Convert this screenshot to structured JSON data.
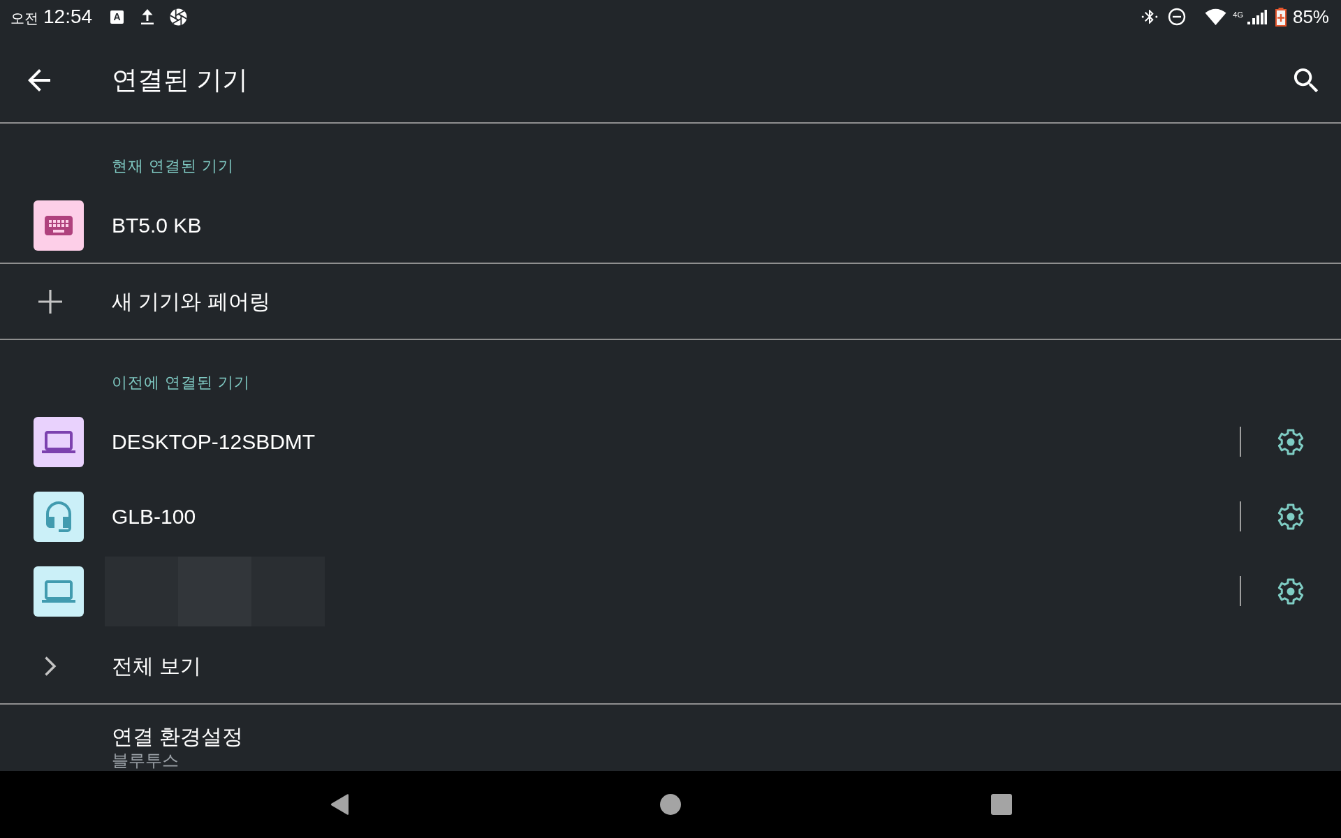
{
  "status_bar": {
    "period": "오전",
    "time": "12:54",
    "notification_icons": [
      {
        "kind": "letter",
        "text": "A"
      },
      {
        "kind": "upload"
      },
      {
        "kind": "aperture"
      }
    ],
    "network_type": "4G",
    "battery_charging": true,
    "battery": "85%"
  },
  "app_bar": {
    "title": "연결된 기기"
  },
  "groups": [
    {
      "header": "현재 연결된 기기",
      "items": [
        {
          "kind": "keyboard",
          "name": "BT5.0 KB",
          "color": "#fdcfe8",
          "redacted": false,
          "settings": false
        }
      ]
    },
    {
      "items": [
        {
          "kind": "add",
          "label": "새 기기와 페어링"
        }
      ]
    },
    {
      "header": "이전에 연결된 기기",
      "items": [
        {
          "kind": "laptop",
          "name": "DESKTOP-12SBDMT",
          "color": "#e9d2fd",
          "redacted": false,
          "settings": true
        },
        {
          "kind": "headset",
          "name": "GLB-100",
          "color": "#cbf0f8",
          "redacted": false,
          "settings": true
        },
        {
          "kind": "laptop",
          "color": "#cbf0f8",
          "redacted": true,
          "settings": true
        },
        {
          "kind": "more",
          "label": "전체 보기"
        }
      ]
    },
    {
      "items": [
        {
          "kind": "preference",
          "title": "연결 환경설정",
          "summary": "블루투스"
        }
      ]
    }
  ]
}
